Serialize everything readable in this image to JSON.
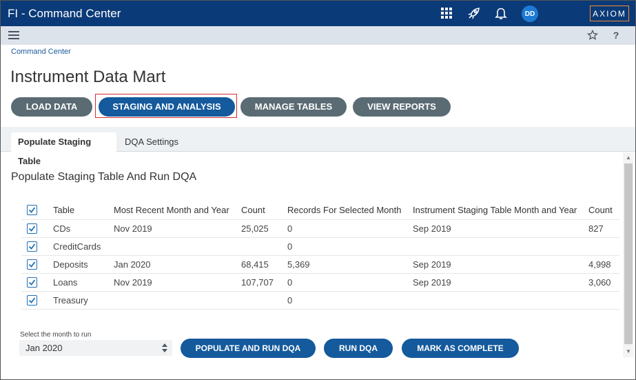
{
  "header": {
    "app_title": "FI - Command Center",
    "icons": [
      "apps-grid-icon",
      "rocket-icon",
      "bell-icon"
    ],
    "user_initials": "DD",
    "logo_text": "AXIOM",
    "brand_color": "#0b3a78",
    "logo_accent": "#f28c28"
  },
  "subbar": {
    "left_icon": "hamburger-menu-icon",
    "right_icons": [
      "star-icon",
      "help-icon"
    ],
    "help_glyph": "?"
  },
  "breadcrumb": "Command Center",
  "page_title": "Instrument Data Mart",
  "nav_buttons": [
    {
      "label": "LOAD DATA",
      "active": false
    },
    {
      "label": "STAGING AND ANALYSIS",
      "active": true
    },
    {
      "label": "MANAGE TABLES",
      "active": false
    },
    {
      "label": "VIEW REPORTS",
      "active": false
    }
  ],
  "tabs": [
    {
      "label": "Populate Staging Table",
      "active": true
    },
    {
      "label": "DQA Settings",
      "active": false
    }
  ],
  "section_title": "Populate Staging Table And Run DQA",
  "table": {
    "headers": [
      "Table",
      "Most Recent Month and Year",
      "Count",
      "Records For Selected Month",
      "Instrument Staging Table Month and Year",
      "Count"
    ],
    "header_checked": true,
    "rows": [
      {
        "checked": true,
        "cells": [
          "CDs",
          "Nov 2019",
          "25,025",
          "0",
          "Sep 2019",
          "827"
        ]
      },
      {
        "checked": true,
        "cells": [
          "CreditCards",
          "",
          "",
          "0",
          "",
          ""
        ]
      },
      {
        "checked": true,
        "cells": [
          "Deposits",
          "Jan 2020",
          "68,415",
          "5,369",
          "Sep 2019",
          "4,998"
        ]
      },
      {
        "checked": true,
        "cells": [
          "Loans",
          "Nov 2019",
          "107,707",
          "0",
          "Sep 2019",
          "3,060"
        ]
      },
      {
        "checked": true,
        "cells": [
          "Treasury",
          "",
          "",
          "0",
          "",
          ""
        ]
      }
    ]
  },
  "month_select": {
    "label": "Select the month to run",
    "value": "Jan 2020"
  },
  "action_buttons": [
    {
      "label": "POPULATE AND RUN DQA"
    },
    {
      "label": "RUN DQA"
    },
    {
      "label": "MARK AS COMPLETE"
    }
  ]
}
